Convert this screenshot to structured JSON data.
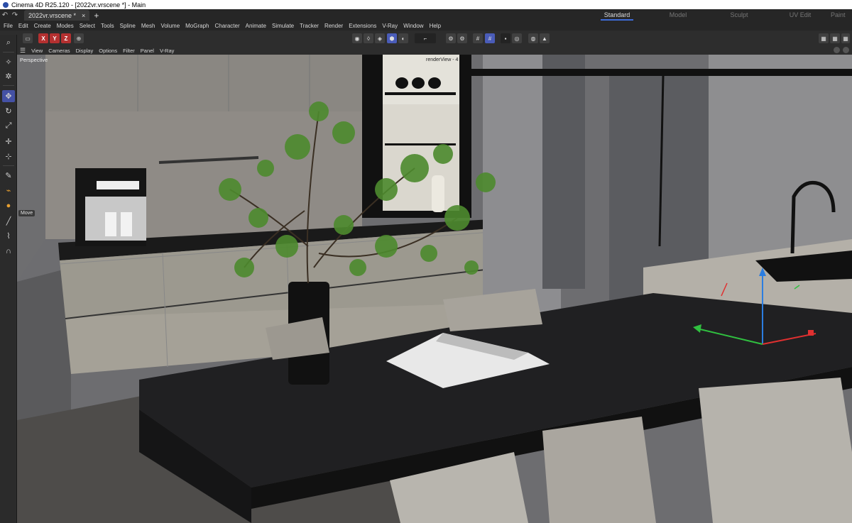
{
  "window": {
    "title": "Cinema 4D R25.120 - [2022vr.vrscene *] - Main"
  },
  "tabs": {
    "document": "2022vr.vrscene *",
    "close": "×",
    "add": "+"
  },
  "layouts": [
    "Standard",
    "Model",
    "Sculpt",
    "UV Edit",
    "Paint"
  ],
  "menu": [
    "File",
    "Edit",
    "Create",
    "Modes",
    "Select",
    "Tools",
    "Spline",
    "Mesh",
    "Volume",
    "MoGraph",
    "Character",
    "Animate",
    "Simulate",
    "Tracker",
    "Render",
    "Extensions",
    "V-Ray",
    "Window",
    "Help"
  ],
  "toolbar": {
    "axis_x": "X",
    "axis_y": "Y",
    "axis_z": "Z"
  },
  "viewport_menu": [
    "View",
    "Cameras",
    "Display",
    "Options",
    "Filter",
    "Panel",
    "V-Ray"
  ],
  "viewport": {
    "camera_label": "Perspective",
    "render_view_label": "renderView - 4",
    "tooltip": "Move"
  },
  "colors": {
    "active_tool": "#4451a5",
    "axis_x": "#e03030",
    "axis_y": "#2b7de0",
    "axis_z": "#30c040",
    "layout_underline": "#3e6bd6"
  },
  "icons": {
    "palette": [
      "magnifier-icon",
      "live-select-icon",
      "null-object-icon",
      "move-icon",
      "rotate-icon",
      "scale-icon",
      "transform-icon",
      "snap-icon",
      "spline-pen-icon",
      "sketch-icon",
      "materials-icon",
      "brush-icon",
      "knife-icon",
      "magnet-icon"
    ]
  }
}
